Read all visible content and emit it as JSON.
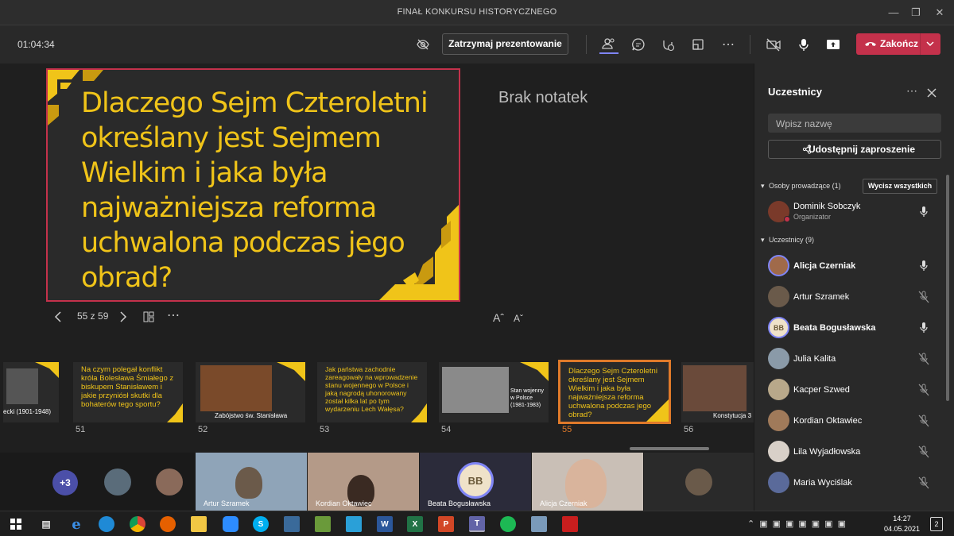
{
  "window": {
    "title": "FINAŁ KONKURSU HISTORYCZNEGO"
  },
  "toolbar": {
    "timer": "01:04:34",
    "stop_presenting": "Zatrzymaj prezentowanie",
    "end_label": "Zakończ",
    "icons": [
      "eye-off-icon",
      "participants-icon",
      "chat-icon",
      "reactions-icon",
      "rooms-icon",
      "more-icon",
      "camera-off-icon",
      "mic-icon",
      "share-icon"
    ]
  },
  "slide": {
    "question": "Dlaczego Sejm Czteroletni określany jest Sejmem Wielkim i jaka była najważniejsza reforma uchwalona podczas jego obrad?",
    "notes": "Brak notatek",
    "counter": "55 z 59",
    "font_up": "Aˆ",
    "font_down": "Aˇ"
  },
  "thumbnails": [
    {
      "num": "",
      "caption": "ecki (1901-1948)",
      "text": ""
    },
    {
      "num": "51",
      "caption": "",
      "text": "Na czym polegał konflikt króla Bolesława Śmiałego z biskupem Stanisławem i jakie przyniósł skutki dla bohaterów tego sportu?"
    },
    {
      "num": "52",
      "caption": "Zabójstwo św. Stanisława",
      "text": ""
    },
    {
      "num": "53",
      "caption": "",
      "text": "Jak państwa zachodnie zareagowały na wprowadzenie stanu wojennego w Polsce i jaką nagrodą uhonorowany został kilka lat po tym wydarzeniu Lech Wałęsa?"
    },
    {
      "num": "54",
      "caption": "Stan wojenny w Polsce (1981-1983)",
      "text": ""
    },
    {
      "num": "55",
      "caption": "",
      "text": "Dlaczego Sejm Czteroletni określany jest Sejmem Wielkim i jaka była najważniejsza reforma uchwalona podczas jego obrad?"
    },
    {
      "num": "56",
      "caption": "Konstytucja 3",
      "text": ""
    }
  ],
  "videos": {
    "extra_count": "+3",
    "tiles": [
      {
        "name": "Artur Szramek"
      },
      {
        "name": "Kordian Oktawiec"
      },
      {
        "name": "Beata Bogusławska",
        "initials": "BB"
      },
      {
        "name": "Alicja Czerniak"
      }
    ]
  },
  "panel": {
    "title": "Uczestnicy",
    "search_placeholder": "Wpisz nazwę",
    "invite": "Udostępnij zaproszenie",
    "organizers_header": "Osoby prowadzące (1)",
    "clear_all": "Wycisz wszystkich",
    "organizer": {
      "name": "Dominik Sobczyk",
      "role": "Organizator"
    },
    "participants_header": "Uczestnicy (9)",
    "participants": [
      {
        "name": "Alicja Czerniak",
        "bold": true,
        "muted": false
      },
      {
        "name": "Artur Szramek",
        "bold": false,
        "muted": true
      },
      {
        "name": "Beata Bogusławska",
        "bold": true,
        "muted": false,
        "initials": "BB"
      },
      {
        "name": "Julia Kalita",
        "bold": false,
        "muted": true
      },
      {
        "name": "Kacper Szwed",
        "bold": false,
        "muted": true
      },
      {
        "name": "Kordian Oktawiec",
        "bold": false,
        "muted": true
      },
      {
        "name": "Lila Wyjadłowska",
        "bold": false,
        "muted": true
      },
      {
        "name": "Maria Wyciślak",
        "bold": false,
        "muted": true
      }
    ]
  },
  "taskbar": {
    "time": "14:27",
    "date": "04.05.2021",
    "notification_count": "2"
  },
  "colors": {
    "accent": "#f0c419",
    "end": "#c4314b",
    "thumb_active": "#e07a2a"
  }
}
